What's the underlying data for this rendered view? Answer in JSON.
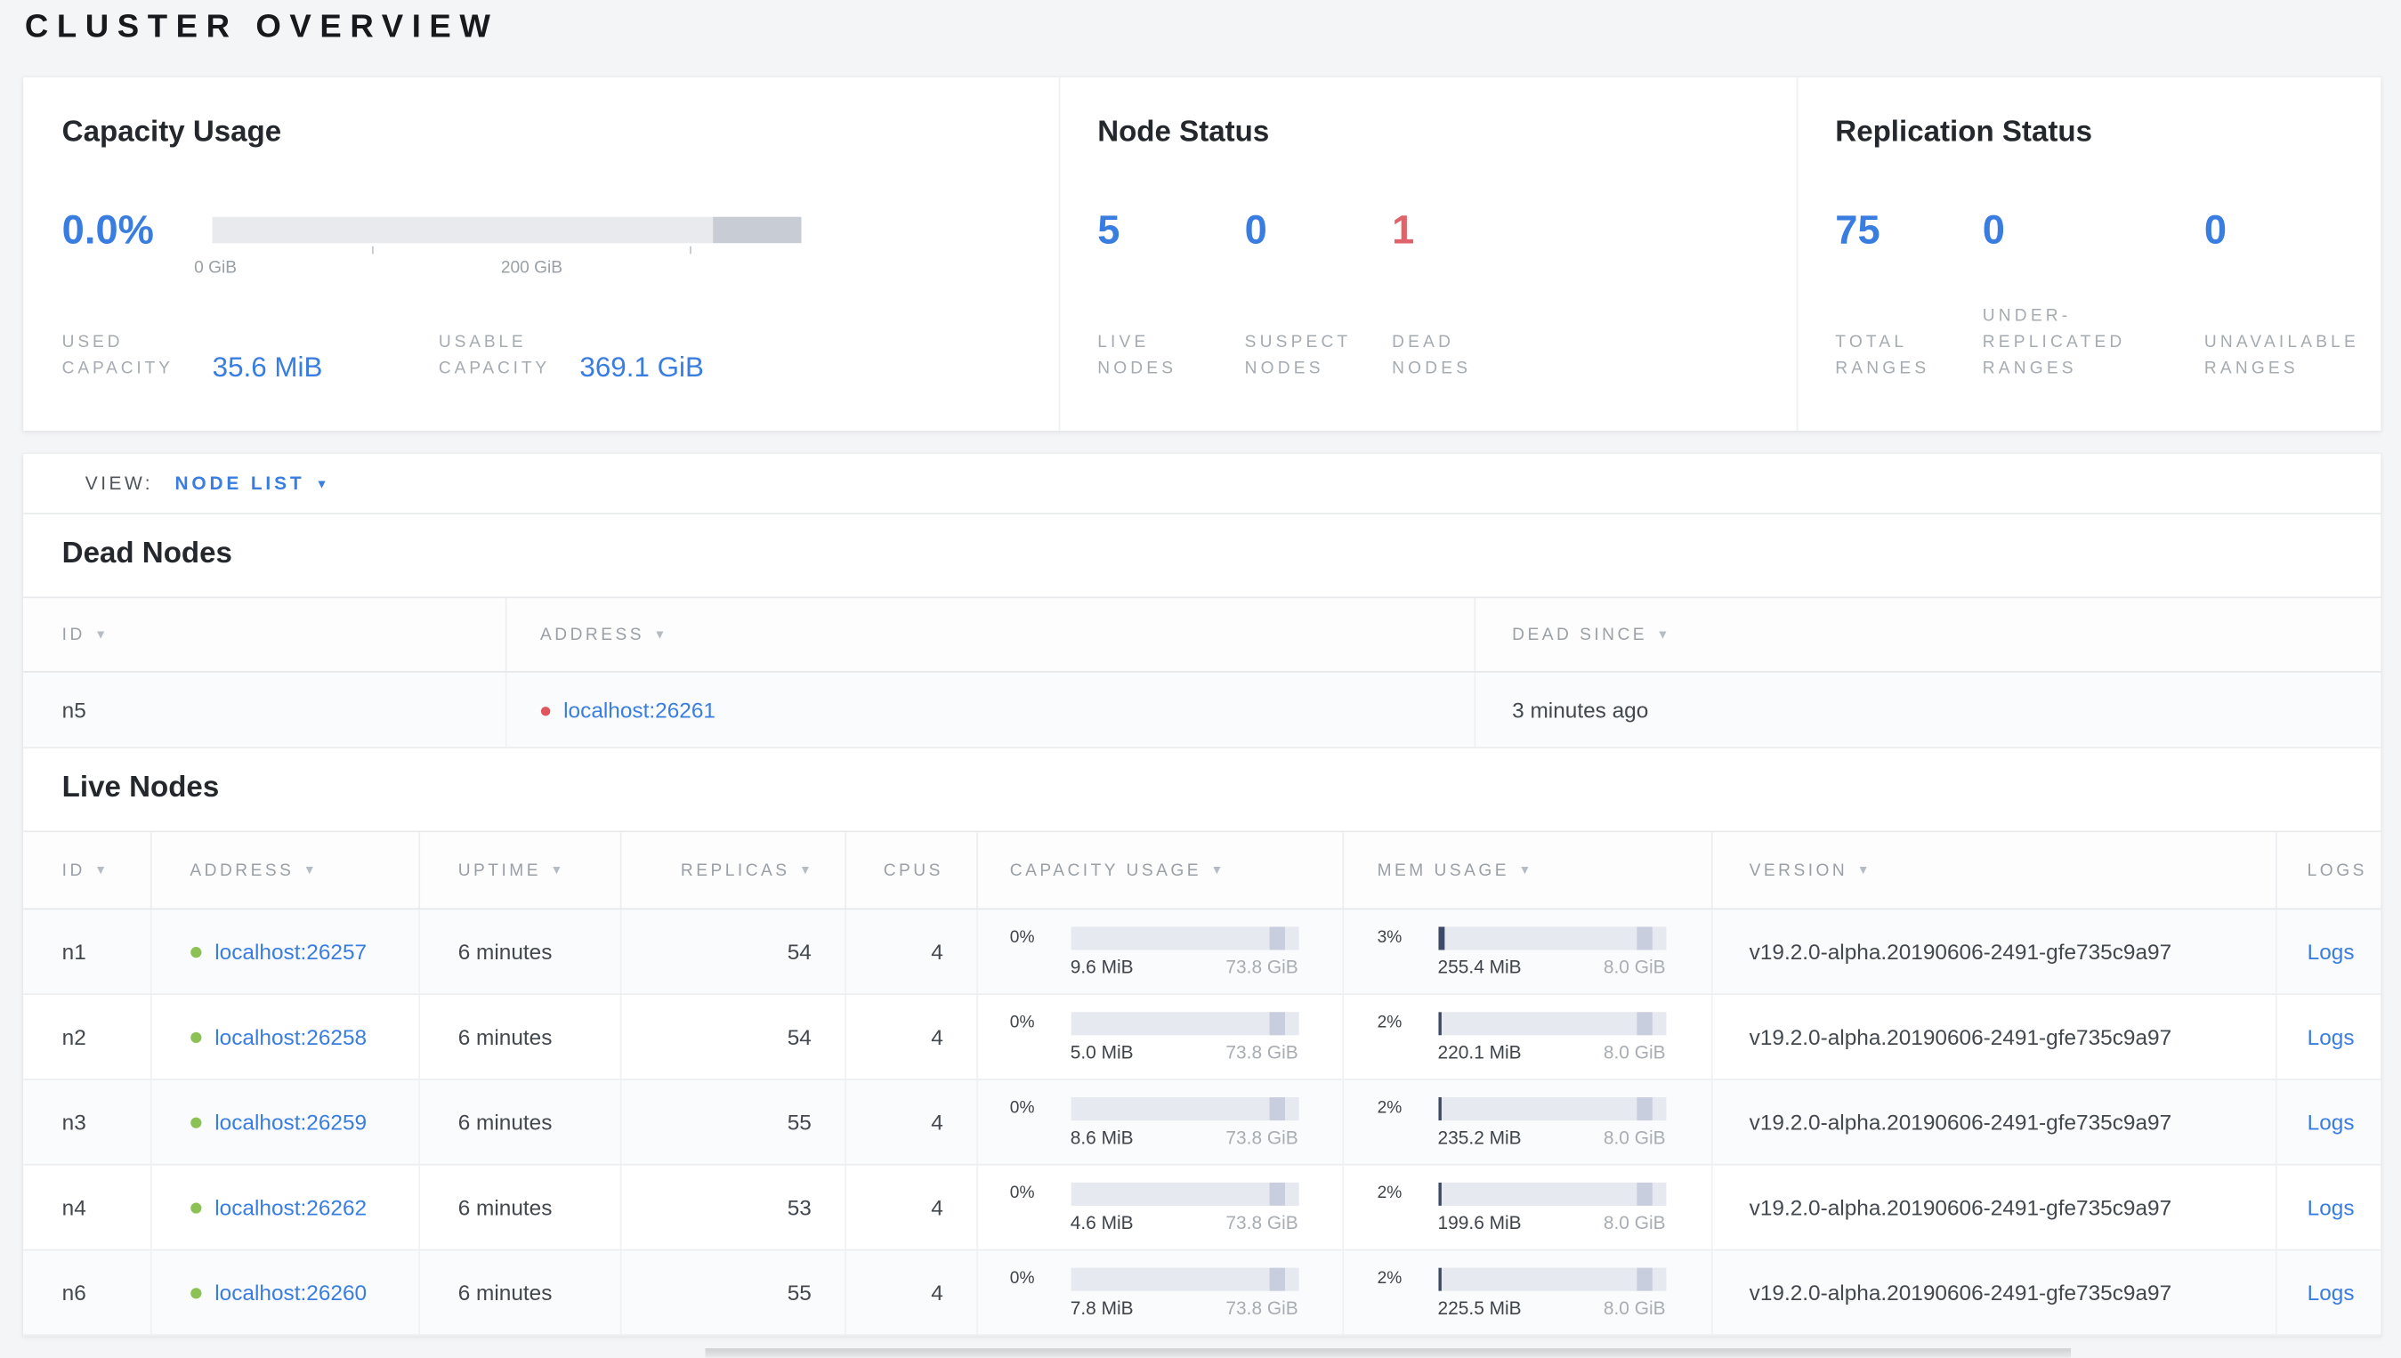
{
  "page": {
    "title": "CLUSTER OVERVIEW"
  },
  "summary": {
    "capacity": {
      "title": "Capacity Usage",
      "percent": "0.0%",
      "axis_ticks": [
        "0 GiB",
        "200 GiB"
      ],
      "used_label": "USED CAPACITY",
      "used_value": "35.6 MiB",
      "usable_label": "USABLE CAPACITY",
      "usable_value": "369.1 GiB"
    },
    "node_status": {
      "title": "Node Status",
      "stats": [
        {
          "value": "5",
          "label": "LIVE NODES"
        },
        {
          "value": "0",
          "label": "SUSPECT NODES"
        },
        {
          "value": "1",
          "label": "DEAD NODES"
        }
      ]
    },
    "replication": {
      "title": "Replication Status",
      "stats": [
        {
          "value": "75",
          "label": "TOTAL RANGES"
        },
        {
          "value": "0",
          "label": "UNDER-REPLICATED RANGES"
        },
        {
          "value": "0",
          "label": "UNAVAILABLE RANGES"
        }
      ]
    }
  },
  "view_bar": {
    "label": "VIEW:",
    "selected": "NODE LIST"
  },
  "dead_nodes": {
    "title": "Dead Nodes",
    "columns": [
      "ID",
      "ADDRESS",
      "DEAD SINCE"
    ],
    "rows": [
      {
        "id": "n5",
        "address": "localhost:26261",
        "dead_since": "3 minutes ago"
      }
    ]
  },
  "live_nodes": {
    "title": "Live Nodes",
    "columns": [
      "ID",
      "ADDRESS",
      "UPTIME",
      "REPLICAS",
      "CPUS",
      "CAPACITY USAGE",
      "MEM USAGE",
      "VERSION",
      "LOGS"
    ],
    "rows": [
      {
        "id": "n1",
        "address": "localhost:26257",
        "uptime": "6 minutes",
        "replicas": "54",
        "cpus": "4",
        "capacity_pct": "0%",
        "capacity_used": "9.6 MiB",
        "capacity_total": "73.8 GiB",
        "mem_pct": "3%",
        "mem_used": "255.4 MiB",
        "mem_total": "8.0 GiB",
        "version": "v19.2.0-alpha.20190606-2491-gfe735c9a97",
        "logs": "Logs"
      },
      {
        "id": "n2",
        "address": "localhost:26258",
        "uptime": "6 minutes",
        "replicas": "54",
        "cpus": "4",
        "capacity_pct": "0%",
        "capacity_used": "5.0 MiB",
        "capacity_total": "73.8 GiB",
        "mem_pct": "2%",
        "mem_used": "220.1 MiB",
        "mem_total": "8.0 GiB",
        "version": "v19.2.0-alpha.20190606-2491-gfe735c9a97",
        "logs": "Logs"
      },
      {
        "id": "n3",
        "address": "localhost:26259",
        "uptime": "6 minutes",
        "replicas": "55",
        "cpus": "4",
        "capacity_pct": "0%",
        "capacity_used": "8.6 MiB",
        "capacity_total": "73.8 GiB",
        "mem_pct": "2%",
        "mem_used": "235.2 MiB",
        "mem_total": "8.0 GiB",
        "version": "v19.2.0-alpha.20190606-2491-gfe735c9a97",
        "logs": "Logs"
      },
      {
        "id": "n4",
        "address": "localhost:26262",
        "uptime": "6 minutes",
        "replicas": "53",
        "cpus": "4",
        "capacity_pct": "0%",
        "capacity_used": "4.6 MiB",
        "capacity_total": "73.8 GiB",
        "mem_pct": "2%",
        "mem_used": "199.6 MiB",
        "mem_total": "8.0 GiB",
        "version": "v19.2.0-alpha.20190606-2491-gfe735c9a97",
        "logs": "Logs"
      },
      {
        "id": "n6",
        "address": "localhost:26260",
        "uptime": "6 minutes",
        "replicas": "55",
        "cpus": "4",
        "capacity_pct": "0%",
        "capacity_used": "7.8 MiB",
        "capacity_total": "73.8 GiB",
        "mem_pct": "2%",
        "mem_used": "225.5 MiB",
        "mem_total": "8.0 GiB",
        "version": "v19.2.0-alpha.20190606-2491-gfe735c9a97",
        "logs": "Logs"
      }
    ]
  },
  "icons": {
    "sort_arrow": "▼",
    "dropdown_caret": "▼"
  },
  "colors": {
    "accent_blue": "#3a7de1",
    "danger_red": "#e0636a",
    "live_green": "#8cc153",
    "dead_red": "#e0565c"
  }
}
